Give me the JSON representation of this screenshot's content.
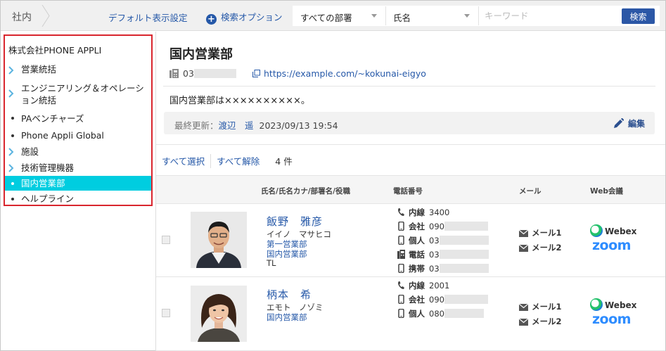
{
  "topbar": {
    "scope": "社内",
    "default_view": "デフォルト表示設定",
    "search_options": "検索オプション",
    "dept_select": "すべての部署",
    "field_select": "氏名",
    "keyword_placeholder": "キーワード",
    "search_button": "検索"
  },
  "sidebar": {
    "org": "株式会社PHONE APPLI",
    "items": [
      {
        "label": "営業統括",
        "marker": "chevron"
      },
      {
        "label": "エンジニアリング＆オペレーション統括",
        "marker": "chevron"
      },
      {
        "label": "PAベンチャーズ",
        "marker": "dot"
      },
      {
        "label": "Phone Appli Global",
        "marker": "dot"
      },
      {
        "label": "施設",
        "marker": "chevron"
      },
      {
        "label": "技術管理機器",
        "marker": "chevron"
      },
      {
        "label": "国内営業部",
        "marker": "dot",
        "active": true
      },
      {
        "label": "ヘルプライン",
        "marker": "dot"
      }
    ]
  },
  "dept": {
    "title": "国内営業部",
    "phone_prefix": "03",
    "url": "https://example.com/~kokunai-eigyo",
    "description": "国内営業部は××××××××××。",
    "updated_label": "最終更新：",
    "updated_by": "渡辺　遥",
    "updated_at": "2023/09/13 19:54",
    "edit": "編集"
  },
  "list": {
    "select_all": "すべて選択",
    "deselect_all": "すべて解除",
    "count": "4 件",
    "headers": {
      "name": "氏名/氏名カナ/部署名/役職",
      "phone": "電話番号",
      "mail": "メール",
      "web": "Web会議"
    }
  },
  "people": [
    {
      "name": "飯野　雅彦",
      "kana": "イイノ　マサヒコ",
      "dept1": "第一営業部",
      "dept2": "国内営業部",
      "title": "TL",
      "phones": {
        "ext_label": "内線",
        "ext": "3400",
        "company_label": "会社",
        "company": "090",
        "personal_label": "個人",
        "personal": "03",
        "tel_label": "電話",
        "tel": "03",
        "mobile_label": "携帯",
        "mobile": "03"
      },
      "mail1": "メール1",
      "mail2": "メール2",
      "webex": "Webex",
      "zoom": "zoom"
    },
    {
      "name": "柄本　希",
      "kana": "エモト　ノゾミ",
      "dept1": "国内営業部",
      "phones": {
        "ext_label": "内線",
        "ext": "2001",
        "company_label": "会社",
        "company": "090",
        "personal_label": "個人",
        "personal": "080"
      },
      "mail1": "メール1",
      "mail2": "メール2",
      "webex": "Webex",
      "zoom": "zoom"
    }
  ]
}
